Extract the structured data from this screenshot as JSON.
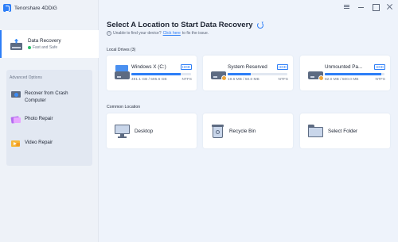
{
  "app": {
    "title": "Tenorshare 4DDiG"
  },
  "sidebar": {
    "primary": {
      "title": "Data Recovery",
      "status": "Fast and Safe"
    },
    "advanced_label": "Advanced Options",
    "advanced_items": [
      {
        "label": "Recover from Crash Computer",
        "icon": "crash-computer-icon"
      },
      {
        "label": "Photo Repair",
        "icon": "photo-repair-icon"
      },
      {
        "label": "Video Repair",
        "icon": "video-repair-icon"
      }
    ]
  },
  "main": {
    "title": "Select A Location to Start Data Recovery",
    "help_prefix": "Unable to find your device?",
    "help_link": "Click here",
    "help_suffix": "to fix the issue.",
    "local_drives_label": "Local Drives (3)",
    "drives": [
      {
        "name": "Windows X (C:)",
        "type": "HDD",
        "size": "491.1 GB / 595.6 GB",
        "fs": "NTFS",
        "used_fraction": 0.82
      },
      {
        "name": "System Reserved",
        "type": "HDD",
        "size": "19.6 MB / 50.0 MB",
        "fs": "NTFS",
        "used_fraction": 0.39
      },
      {
        "name": "Unmounted Pa...",
        "type": "HDD",
        "size": "82.0 MB / 500.0 MB",
        "fs": "NTFS",
        "used_fraction": 0.95
      }
    ],
    "common_label": "Common Location",
    "locations": [
      {
        "label": "Desktop"
      },
      {
        "label": "Recycle Bin"
      },
      {
        "label": "Select Folder"
      }
    ]
  },
  "colors": {
    "accent": "#2d7ef7",
    "success": "#2bbd6a",
    "warning": "#f0a63a"
  }
}
